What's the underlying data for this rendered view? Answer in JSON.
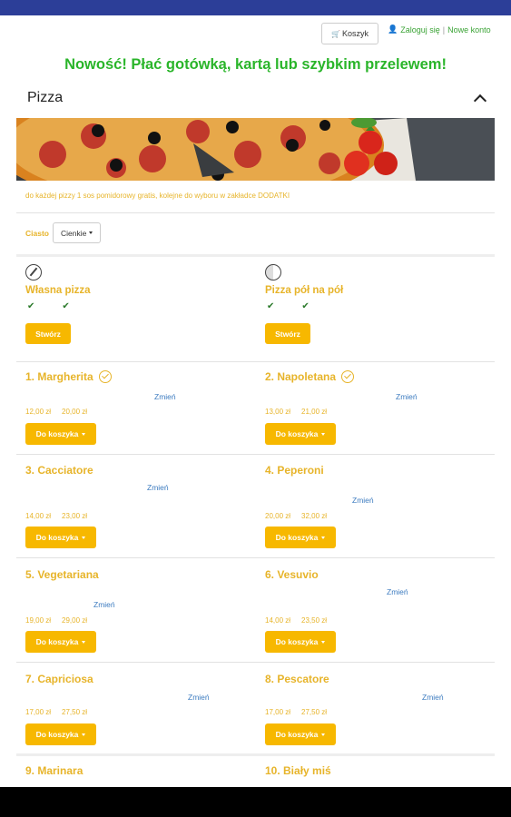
{
  "header": {
    "cart_label": "Koszyk",
    "login_label": "Zaloguj się",
    "separator": "|",
    "new_account_label": "Nowe konto"
  },
  "promo": "Nowość! Płać gotówką, kartą lub szybkim przelewem!",
  "section": {
    "title": "Pizza",
    "note": "do każdej pizzy 1 sos pomidorowy gratis, kolejne do wyboru w zakładce DODATKI"
  },
  "dough": {
    "label": "Ciasto",
    "selected": "Cienkie"
  },
  "specials": [
    {
      "title": "Własna pizza",
      "checks": [
        "✔",
        "✔"
      ],
      "button": "Stwórz"
    },
    {
      "title": "Pizza pół na pół",
      "checks": [
        "✔",
        "✔"
      ],
      "button": "Stwórz"
    }
  ],
  "pizzas": [
    {
      "name": "1. Margherita",
      "vegetarian": true,
      "change": "Zmień",
      "price_small": "12,00 zł",
      "price_large": "20,00 zł",
      "button": "Do koszyka"
    },
    {
      "name": "2. Napoletana",
      "vegetarian": true,
      "change": "Zmień",
      "price_small": "13,00 zł",
      "price_large": "21,00 zł",
      "button": "Do koszyka"
    },
    {
      "name": "3. Cacciatore",
      "vegetarian": false,
      "change": "Zmień",
      "price_small": "14,00 zł",
      "price_large": "23,00 zł",
      "button": "Do koszyka"
    },
    {
      "name": "4. Peperoni",
      "vegetarian": false,
      "change": "Zmień",
      "price_small": "20,00 zł",
      "price_large": "32,00 zł",
      "button": "Do koszyka"
    },
    {
      "name": "5. Vegetariana",
      "vegetarian": false,
      "change": "Zmień",
      "price_small": "19,00 zł",
      "price_large": "29,00 zł",
      "button": "Do koszyka"
    },
    {
      "name": "6. Vesuvio",
      "vegetarian": false,
      "change": "Zmień",
      "price_small": "14,00 zł",
      "price_large": "23,50 zł",
      "button": "Do koszyka"
    },
    {
      "name": "7. Capriciosa",
      "vegetarian": false,
      "change": "Zmień",
      "price_small": "17,00 zł",
      "price_large": "27,50 zł",
      "button": "Do koszyka"
    },
    {
      "name": "8. Pescatore",
      "vegetarian": false,
      "change": "Zmień",
      "price_small": "17,00 zł",
      "price_large": "27,50 zł",
      "button": "Do koszyka"
    },
    {
      "name": "9. Marinara",
      "vegetarian": false
    },
    {
      "name": "10. Biały miś",
      "vegetarian": false
    }
  ],
  "colors": {
    "accent": "#f7b800",
    "title_yellow": "#e7b42a",
    "promo_green": "#2ab52a",
    "link_blue": "#3d7cc0",
    "topbar": "#2c3e98"
  }
}
